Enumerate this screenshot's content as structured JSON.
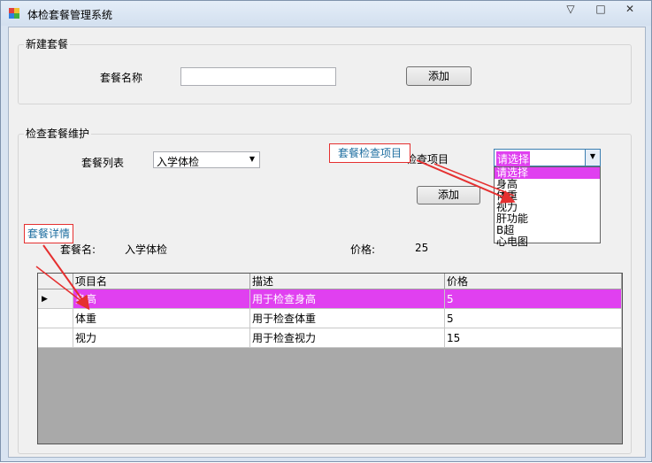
{
  "window": {
    "title": "体检套餐管理系统",
    "minimize": "▽",
    "maximize": "□",
    "close": "✕"
  },
  "new_package": {
    "group_title": "新建套餐",
    "name_label": "套餐名称",
    "name_value": "",
    "add_button": "添加"
  },
  "maintain": {
    "group_title": "检查套餐维护",
    "list_label": "套餐列表",
    "list_value": "入学体检",
    "item_label": "检查项目",
    "item_value": "请选择",
    "add_button": "添加",
    "dropdown_options": [
      "请选择",
      "身高",
      "体重",
      "视力",
      "肝功能",
      "B超",
      "心电图"
    ],
    "package_name_label": "套餐名:",
    "package_name_value": "入学体检",
    "price_label": "价格:",
    "price_value": "25"
  },
  "annotations": {
    "items_callout": "套餐检查项目",
    "details_callout": "套餐详情",
    "arrow_color": "#e53030"
  },
  "grid": {
    "columns": [
      "项目名",
      "描述",
      "价格"
    ],
    "rows": [
      {
        "name": "身高",
        "desc": "用于检查身高",
        "price": "5"
      },
      {
        "name": "体重",
        "desc": "用于检查体重",
        "price": "5"
      },
      {
        "name": "视力",
        "desc": "用于检查视力",
        "price": "15"
      }
    ],
    "selected_row": 0,
    "current_row_marker": "▶",
    "selection_color": "#e040f0"
  }
}
